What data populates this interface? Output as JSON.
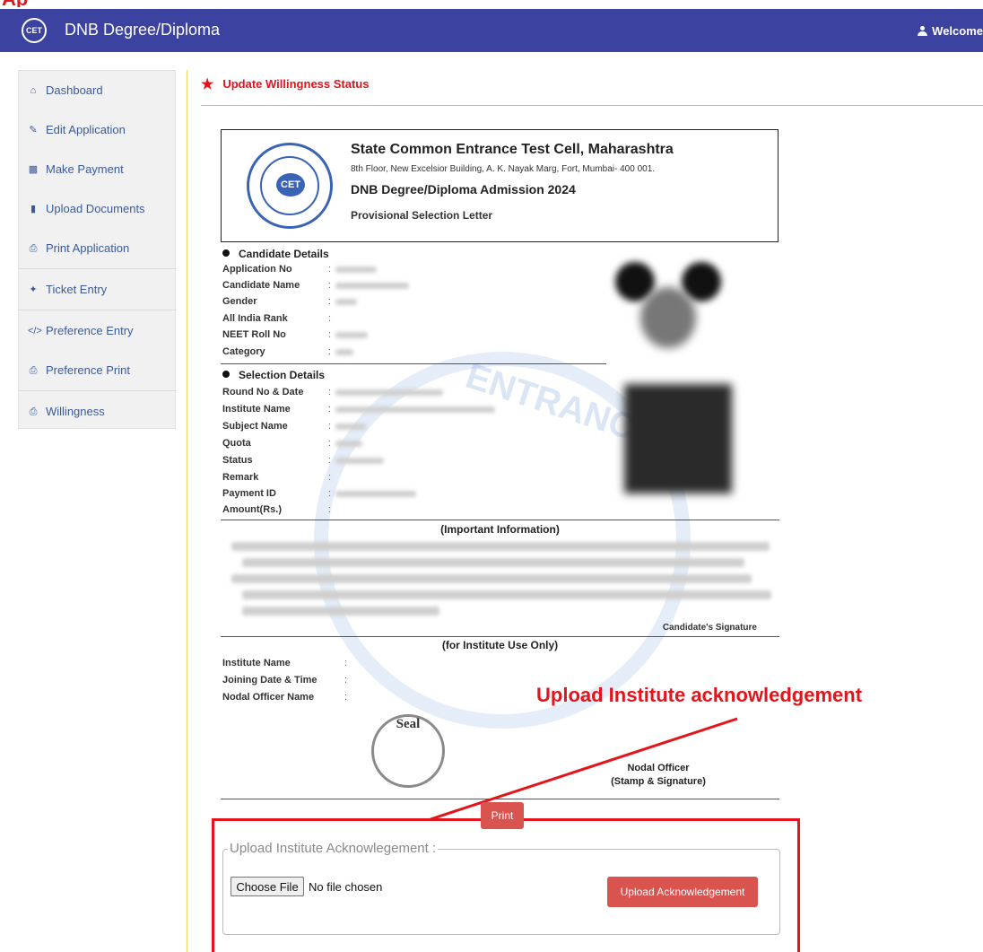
{
  "colors": {
    "navbar": "#3b42a0",
    "accent_red": "#e4141b",
    "button_red": "#d9534f",
    "sidebar_link": "#3c5a99"
  },
  "navbar": {
    "logo_text": "CET",
    "brand": "DNB Degree/Diploma",
    "welcome": "Welcome",
    "user_icon": "user-icon"
  },
  "sidebar": {
    "items": [
      {
        "label": "Dashboard",
        "icon": "home-icon"
      },
      {
        "label": "Edit Application",
        "icon": "edit-icon"
      },
      {
        "label": "Make Payment",
        "icon": "money-icon"
      },
      {
        "label": "Upload Documents",
        "icon": "file-icon"
      },
      {
        "label": "Print Application",
        "icon": "print-icon"
      },
      {
        "label": "Ticket Entry",
        "icon": "ticket-icon"
      },
      {
        "label": "Preference Entry",
        "icon": "code-icon"
      },
      {
        "label": "Preference Print",
        "icon": "print-icon"
      },
      {
        "label": "Willingness",
        "icon": "print-icon"
      }
    ]
  },
  "page": {
    "title": "Update Willingness Status",
    "title_icon": "star-icon"
  },
  "letter": {
    "logo_text": "CET",
    "org_title": "State Common Entrance Test Cell, Maharashtra",
    "address": "8th Floor, New Excelsior Building, A. K. Nayak Marg, Fort, Mumbai- 400 001.",
    "admission": "DNB Degree/Diploma Admission 2024",
    "letter_type": "Provisional Selection Letter",
    "watermark_text": "ENTRANC"
  },
  "candidate": {
    "heading": "Candidate Details",
    "fields": [
      "Application No",
      "Candidate Name",
      "Gender",
      "All India Rank",
      "NEET Roll No",
      "Category"
    ]
  },
  "selection": {
    "heading": "Selection Details",
    "fields": [
      "Round No & Date",
      "Institute Name",
      "Subject Name",
      "Quota",
      "Status",
      "Remark",
      "Payment ID",
      "Amount(Rs.)"
    ]
  },
  "info": {
    "heading": "(Important Information)",
    "signature": "Candidate's Signature"
  },
  "institute": {
    "heading": "(for Institute Use Only)",
    "fields": [
      "Institute Name",
      "Joining Date & Time",
      "Nodal Officer Name"
    ],
    "seal": "Seal",
    "nodal_line1": "Nodal Officer",
    "nodal_line2": "(Stamp & Signature)"
  },
  "actions": {
    "print": "Print"
  },
  "annotation": {
    "text": "Upload Institute acknowledgement"
  },
  "upload": {
    "legend": "Upload Institute Acknowlegement :",
    "choose": "Choose File",
    "no_file": "No file chosen",
    "submit": "Upload Acknowledgement"
  }
}
